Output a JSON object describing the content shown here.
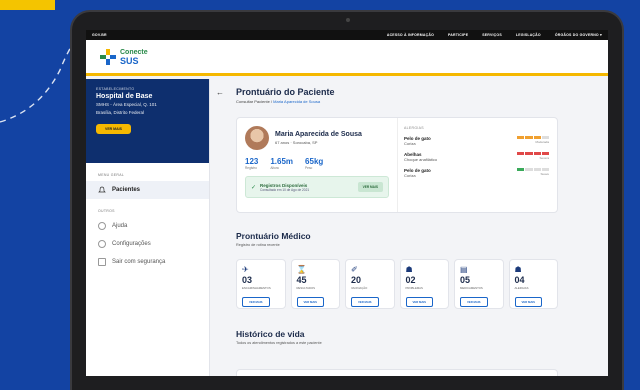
{
  "gov_bar": {
    "brand": "GOV.BR",
    "links": [
      "ACESSO À INFORMAÇÃO",
      "PARTICIPE",
      "SERVIÇOS",
      "LEGISLAÇÃO",
      "ÓRGÃOS DO GOVERNO ▾"
    ]
  },
  "logo": {
    "line1": "Conecte",
    "line2": "SUS"
  },
  "establishment": {
    "label": "ESTABELECIMENTO",
    "name": "Hospital de Base",
    "address1": "SMHS - Área Especial, Q. 101",
    "address2": "Brasília, Distrito Federal",
    "button": "VER MAIS"
  },
  "menu": {
    "main_header": "MENU GERAL",
    "patients": "Pacientes",
    "others_header": "OUTROS",
    "help": "Ajuda",
    "settings": "Configurações",
    "logout": "Sair com segurança"
  },
  "page": {
    "title": "Prontuário do Paciente",
    "breadcrumb_root": "Consultar Paciente /",
    "breadcrumb_current": "Maria Aparecida de Sousa"
  },
  "patient": {
    "name": "Maria Aparecida de Sousa",
    "info": "67 anos · Sorocaba, SP",
    "stats": [
      {
        "value": "123",
        "label": "Registro"
      },
      {
        "value": "1.65m",
        "label": "Altura"
      },
      {
        "value": "65kg",
        "label": "Peso"
      }
    ],
    "records_title": "Registros Disponíveis",
    "records_sub": "Consultado em 10 de Ago de 2021",
    "records_button": "VER MAIS"
  },
  "allergies": {
    "header": "ALERGIAS",
    "items": [
      {
        "title": "Pelo de gato",
        "sub": "Coriza",
        "severity": "Moderada",
        "color": "#f0a030",
        "level": 3
      },
      {
        "title": "Abelhas",
        "sub": "Choque anafilático",
        "severity": "Severa",
        "color": "#e04848",
        "level": 4
      },
      {
        "title": "Pelo de gato",
        "sub": "Coriza",
        "severity": "Suave",
        "color": "#3aaa5a",
        "level": 1
      }
    ]
  },
  "medical": {
    "title": "Prontuário Médico",
    "subtitle": "Registro de rotina recente",
    "tiles": [
      {
        "icon": "✈",
        "count": "03",
        "label": "ENCAMINHAMENTOS",
        "button": "VER MAIS"
      },
      {
        "icon": "⌛",
        "count": "45",
        "label": "RESULTADOS",
        "button": "VER MAIS"
      },
      {
        "icon": "✐",
        "count": "20",
        "label": "VACINAÇÃO",
        "button": "VER MAIS"
      },
      {
        "icon": "☗",
        "count": "02",
        "label": "PROBLEMAS",
        "button": "VER MAIS"
      },
      {
        "icon": "▤",
        "count": "05",
        "label": "MEDICAMENTOS",
        "button": "VER MAIS"
      },
      {
        "icon": "☗",
        "count": "04",
        "label": "ALERGIAS",
        "button": "VER MAIS"
      }
    ]
  },
  "history": {
    "title": "Histórico de vida",
    "subtitle": "Todos os atendimentos registrados a este paciente"
  }
}
